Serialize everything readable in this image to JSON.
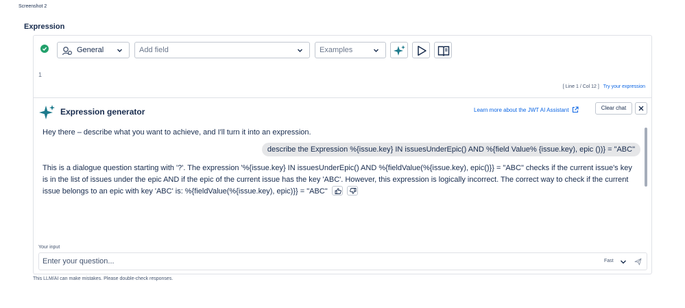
{
  "screenshot_label": "Screenshot 2",
  "section_title": "Expression",
  "toolbar": {
    "status_icon": "check-circle-icon",
    "category_select": "General",
    "field_select_placeholder": "Add field",
    "examples_select": "Examples",
    "buttons": [
      "ai-sparkle-icon",
      "run-icon",
      "docs-icon"
    ]
  },
  "editor": {
    "line_number": "1",
    "cursor_status": "[ Line 1 / Col 12 ]",
    "try_link": "Try your expression"
  },
  "generator": {
    "title": "Expression generator",
    "learn_more": "Learn more about the JWT AI Assistant",
    "clear_chat": "Clear chat",
    "intro_message": "Hey there – describe what you want to achieve, and I'll turn it into an expression.",
    "user_message": "describe the Expression %{issue.key} IN issuesUnderEpic() AND %{field Value% {issue.key), epic ())} = \"ABC\"",
    "assistant_message": "This is a dialogue question starting with '?'. The expression '%{issue.key} IN issuesUnderEpic() AND %{fieldValue(%{issue.key), epic()}} = \"ABC\" checks if the current issue's key is in the list of issues under the epic AND if the epic of the current issue has the key 'ABC'. However, this expression is logically incorrect. The correct way to check if the current issue belongs to an epic with key 'ABC' is: %{fieldValue(%{issue.key), epic)}} = \"ABC\"",
    "input_label": "Your input",
    "input_placeholder": "Enter your question...",
    "speed": "Fast"
  },
  "disclaimer": "This LLM/AI can make mistakes. Please double-check responses.",
  "colors": {
    "link": "#0c66e4",
    "success": "#22a06b",
    "user_bubble": "#e5e6e8"
  }
}
